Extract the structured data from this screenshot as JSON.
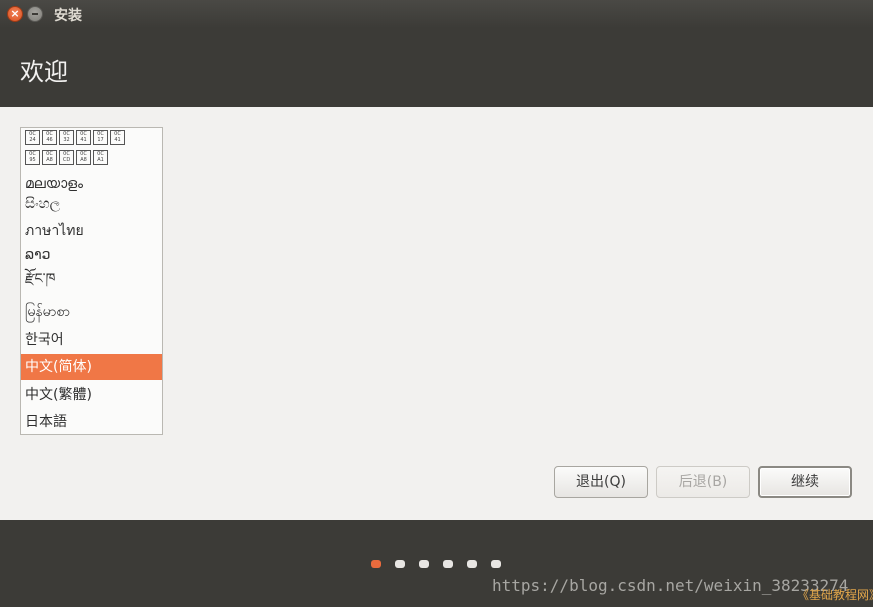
{
  "window": {
    "title": "安装"
  },
  "header": {
    "title": "欢迎"
  },
  "languages": [
    {
      "label": "▯▯▯▯▯",
      "boxes": [
        "0C24",
        "0C46",
        "0C32",
        "0C41",
        "0C17",
        "0C41"
      ],
      "selected": false
    },
    {
      "label": "▯▯▯▯",
      "boxes": [
        "0C95",
        "0CA8",
        "0CCD",
        "0CA8",
        "0CA1"
      ],
      "selected": false
    },
    {
      "label": "മലയാളം",
      "selected": false
    },
    {
      "label": "සිංහල",
      "selected": false
    },
    {
      "label": "ภาษาไทย",
      "selected": false
    },
    {
      "label": "ລາວ",
      "selected": false
    },
    {
      "label": "རྫོང་ཁ",
      "selected": false
    },
    {
      "label": "မြန်မာစာ",
      "selected": false
    },
    {
      "label": "한국어",
      "selected": false
    },
    {
      "label": "中文(简体)",
      "selected": true
    },
    {
      "label": "中文(繁體)",
      "selected": false
    },
    {
      "label": "日本語",
      "selected": false
    }
  ],
  "buttons": {
    "quit": "退出(Q)",
    "back": "后退(B)",
    "continue": "继续"
  },
  "progress": {
    "total_steps": 6,
    "current_step": 1
  },
  "watermark": {
    "url": "https://blog.csdn.net/weixin_38233274",
    "site": "《基础教程网》"
  },
  "colors": {
    "accent": "#f07746",
    "titlebar": "#3c3b37",
    "content_bg": "#f2f1ef"
  }
}
